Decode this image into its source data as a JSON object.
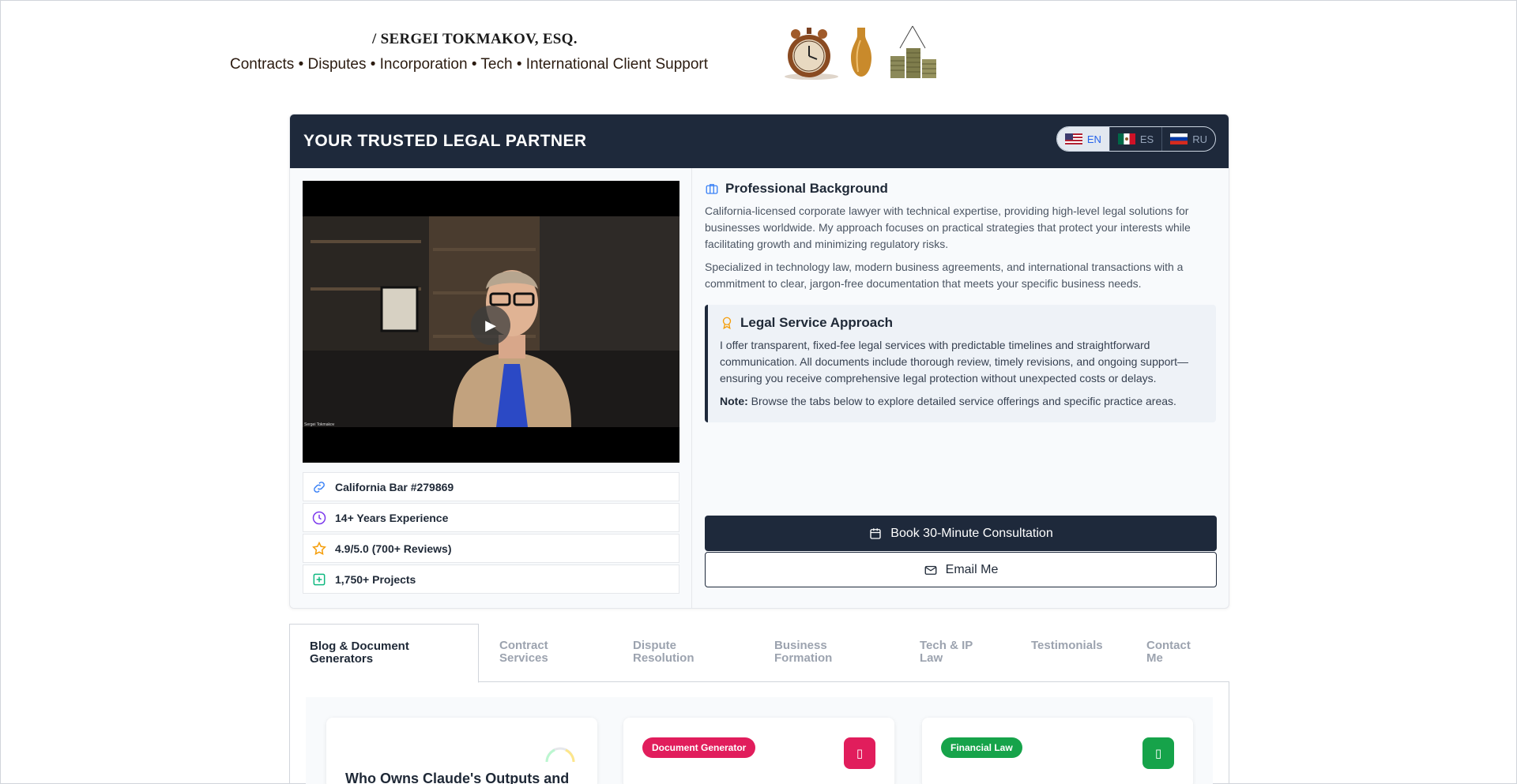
{
  "header": {
    "brand_name": "/ SERGEI TOKMAKOV, ESQ.",
    "tagline": "Contracts • Disputes • Incorporation • Tech • International Client Support"
  },
  "card": {
    "title": "YOUR TRUSTED LEGAL PARTNER",
    "languages": [
      {
        "code": "EN",
        "active": true
      },
      {
        "code": "ES",
        "active": false
      },
      {
        "code": "RU",
        "active": false
      }
    ],
    "video": {
      "caption": "Sergei Tokmakov"
    },
    "stats": [
      {
        "icon": "link-icon",
        "label": "California Bar #279869"
      },
      {
        "icon": "clock-icon",
        "label": "14+ Years Experience"
      },
      {
        "icon": "star-icon",
        "label": "4.9/5.0 (700+ Reviews)"
      },
      {
        "icon": "plus-square-icon",
        "label": "1,750+ Projects"
      }
    ],
    "background": {
      "heading": "Professional Background",
      "para1": "California-licensed corporate lawyer with technical expertise, providing high-level legal solutions for businesses worldwide. My approach focuses on practical strategies that protect your interests while facilitating growth and minimizing regulatory risks.",
      "para2": "Specialized in technology law, modern business agreements, and international transactions with a commitment to clear, jargon-free documentation that meets your specific business needs."
    },
    "approach": {
      "heading": "Legal Service Approach",
      "para": "I offer transparent, fixed-fee legal services with predictable timelines and straightforward communication. All documents include thorough review, timely revisions, and ongoing support—ensuring you receive comprehensive legal protection without unexpected costs or delays.",
      "note_label": "Note:",
      "note_text": " Browse the tabs below to explore detailed service offerings and specific practice areas."
    },
    "cta": {
      "book_label": "Book 30-Minute Consultation",
      "email_label": "Email Me"
    }
  },
  "tabs": [
    {
      "line1": "Blog & Document",
      "line2": "Generators",
      "active": true
    },
    {
      "line1": "Contract",
      "line2": "Services",
      "active": false
    },
    {
      "line1": "Dispute",
      "line2": "Resolution",
      "active": false
    },
    {
      "line1": "Business",
      "line2": "Formation",
      "active": false
    },
    {
      "line1": "Tech & IP",
      "line2": "Law",
      "active": false
    },
    {
      "line1": "Testimonials",
      "line2": "",
      "active": false
    },
    {
      "line1": "Contact",
      "line2": "Me",
      "active": false
    }
  ],
  "posts": [
    {
      "badge": "",
      "title": "Who Owns Claude's Outputs and"
    },
    {
      "badge": "Document Generator",
      "badge_color": "#e11d5c",
      "icon_char": "▯",
      "title": ""
    },
    {
      "badge": "Financial Law",
      "badge_color": "#16a34a",
      "icon_char": "▯",
      "title": ""
    }
  ]
}
